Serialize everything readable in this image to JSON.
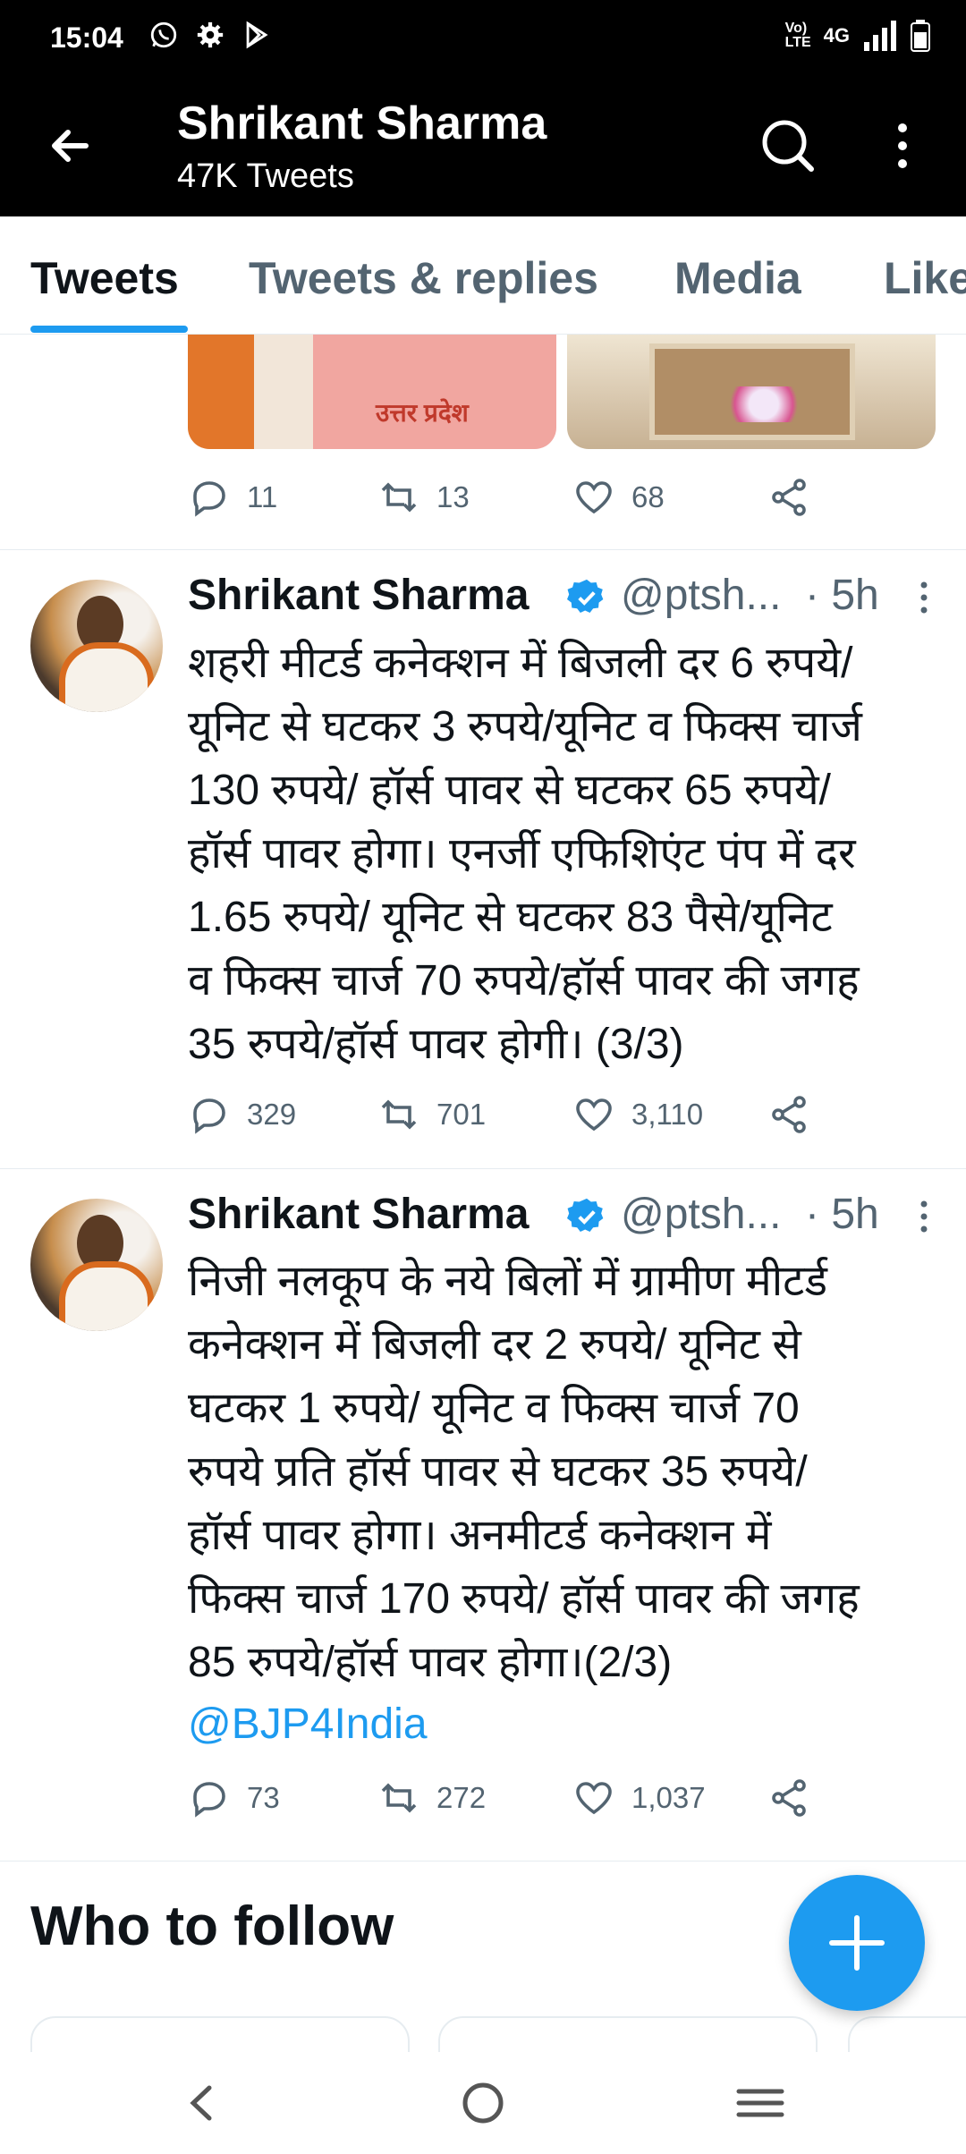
{
  "status_bar": {
    "time": "15:04",
    "network": "4G"
  },
  "header": {
    "name": "Shrikant Sharma",
    "tweet_count": "47K Tweets"
  },
  "tabs": [
    {
      "label": "Tweets",
      "active": true
    },
    {
      "label": "Tweets & replies",
      "active": false
    },
    {
      "label": "Media",
      "active": false
    },
    {
      "label": "Likes",
      "active": false
    }
  ],
  "top_tweet": {
    "media_text": "उत्तर प्रदेश",
    "stats": {
      "replies": "11",
      "retweets": "13",
      "likes": "68"
    }
  },
  "tweets": [
    {
      "name": "Shrikant Sharma",
      "handle": "@ptsh...",
      "time": "· 5h",
      "text": "शहरी मीटर्ड कनेक्शन में बिजली दर 6 रुपये/\nयूनिट से घटकर 3 रुपये/यूनिट व फिक्स चार्ज\n130 रुपये/ हॉर्स पावर से घटकर 65 रुपये/\nहॉर्स पावर होगा। एनर्जी एफिशिएंट पंप में दर\n1.65 रुपये/ यूनिट से घटकर 83 पैसे/यूनिट\nव फिक्स चार्ज 70 रुपये/हॉर्स पावर की जगह\n35 रुपये/हॉर्स पावर होगी। (3/3)",
      "stats": {
        "replies": "329",
        "retweets": "701",
        "likes": "3,110"
      }
    },
    {
      "name": "Shrikant Sharma",
      "handle": "@ptsh...",
      "time": "· 5h",
      "text": "निजी नलकूप के नये बिलों में ग्रामीण मीटर्ड\nकनेक्शन में बिजली दर 2 रुपये/ यूनिट से\nघटकर 1 रुपये/ यूनिट व फिक्स चार्ज 70\nरुपये प्रति हॉर्स पावर से घटकर 35 रुपये/\nहॉर्स पावर होगा। अनमीटर्ड कनेक्शन में\nफिक्स चार्ज 170 रुपये/ हॉर्स पावर की जगह\n85 रुपये/हॉर्स पावर होगा।(2/3)",
      "mention": "@BJP4India",
      "stats": {
        "replies": "73",
        "retweets": "272",
        "likes": "1,037"
      }
    }
  ],
  "who_to_follow": {
    "title": "Who to follow"
  },
  "colors": {
    "accent": "#1d9bf0",
    "text": "#0f1419",
    "secondary": "#536471"
  }
}
